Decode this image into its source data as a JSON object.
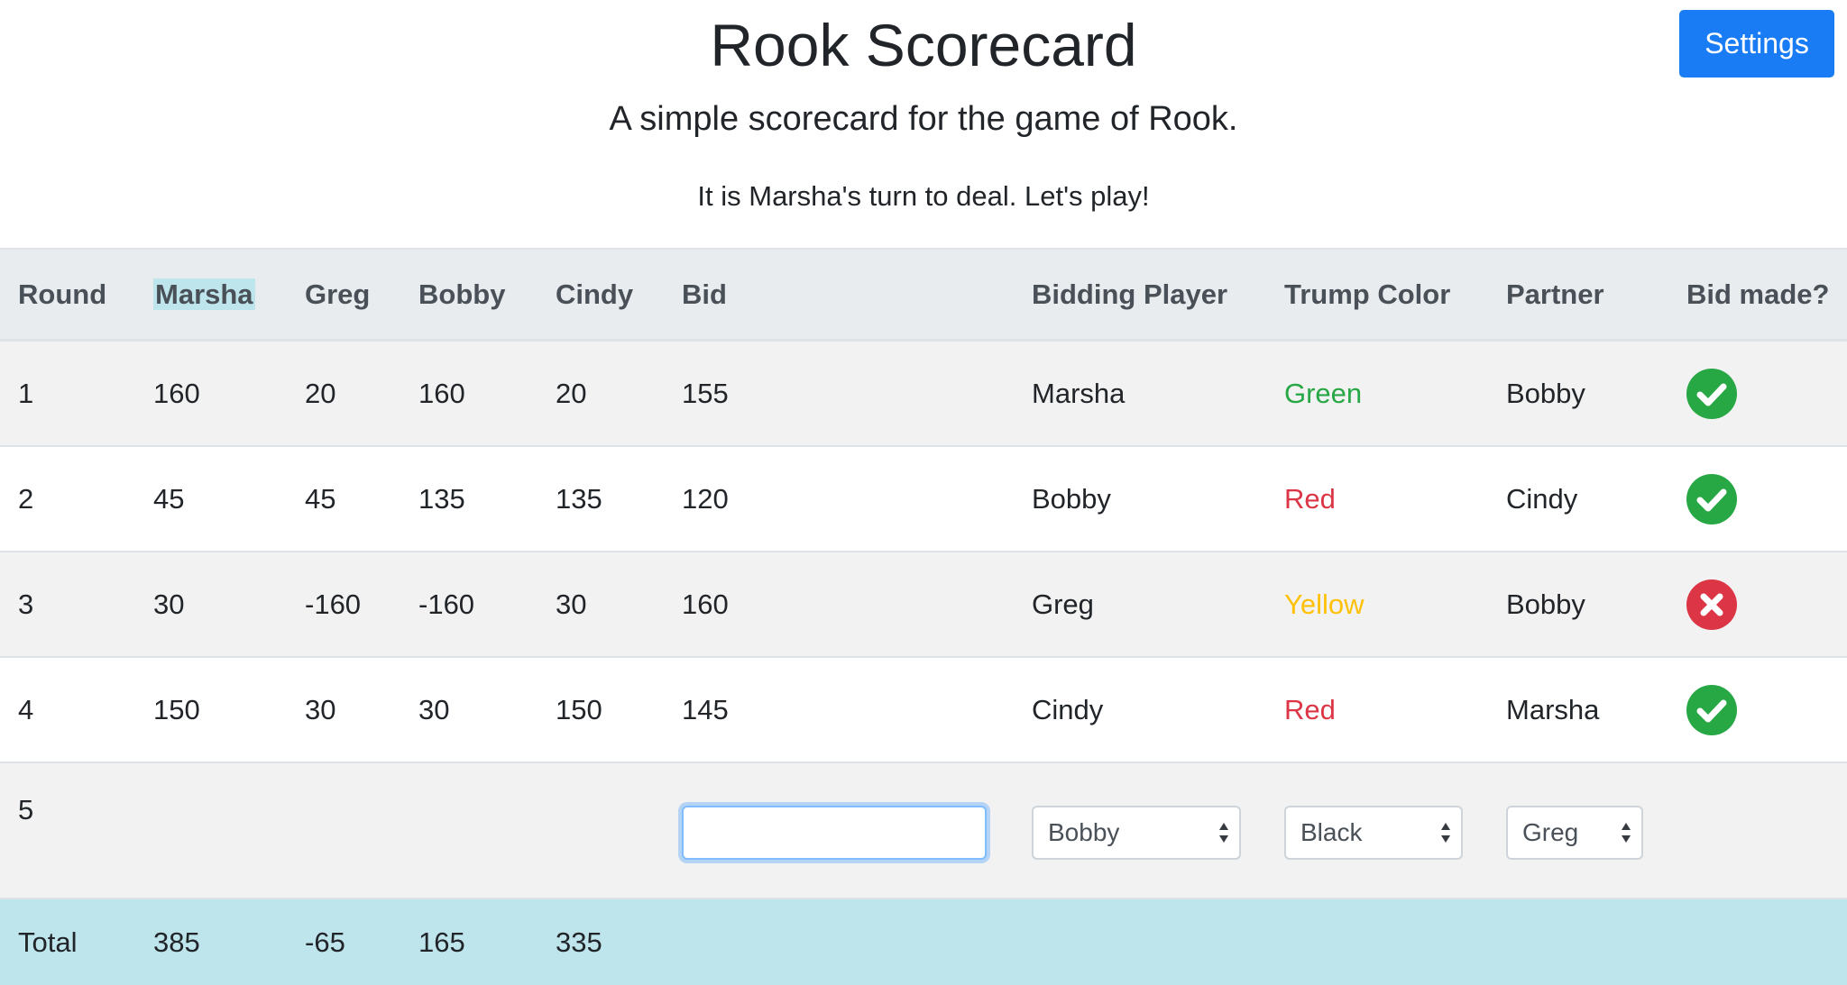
{
  "header": {
    "title": "Rook Scorecard",
    "subtitle": "A simple scorecard for the game of Rook.",
    "turn_message": "It is Marsha's turn to deal. Let's play!",
    "settings_label": "Settings"
  },
  "table": {
    "columns": [
      "Round",
      "Marsha",
      "Greg",
      "Bobby",
      "Cindy",
      "Bid",
      "Bidding Player",
      "Trump Color",
      "Partner",
      "Bid made?"
    ],
    "highlighted_column": "Marsha",
    "rows": [
      {
        "round": "1",
        "marsha": "160",
        "greg": "20",
        "bobby": "160",
        "cindy": "20",
        "bid": "155",
        "bidding_player": "Marsha",
        "trump_color": "Green",
        "trump_color_hex": "#28a745",
        "partner": "Bobby",
        "bid_made": "yes"
      },
      {
        "round": "2",
        "marsha": "45",
        "greg": "45",
        "bobby": "135",
        "cindy": "135",
        "bid": "120",
        "bidding_player": "Bobby",
        "trump_color": "Red",
        "trump_color_hex": "#dc3545",
        "partner": "Cindy",
        "bid_made": "yes"
      },
      {
        "round": "3",
        "marsha": "30",
        "greg": "-160",
        "bobby": "-160",
        "cindy": "30",
        "bid": "160",
        "bidding_player": "Greg",
        "trump_color": "Yellow",
        "trump_color_hex": "#ffc107",
        "partner": "Bobby",
        "bid_made": "no"
      },
      {
        "round": "4",
        "marsha": "150",
        "greg": "30",
        "bobby": "30",
        "cindy": "150",
        "bid": "145",
        "bidding_player": "Cindy",
        "trump_color": "Red",
        "trump_color_hex": "#dc3545",
        "partner": "Marsha",
        "bid_made": "yes"
      }
    ],
    "entry_row": {
      "round": "5",
      "bid_value": "",
      "bidding_player_selected": "Bobby",
      "trump_color_selected": "Black",
      "partner_selected": "Greg"
    },
    "total_row": {
      "label": "Total",
      "marsha": "385",
      "greg": "-65",
      "bobby": "165",
      "cindy": "335"
    }
  },
  "colors": {
    "accent": "#1a7cf5",
    "success": "#28a745",
    "danger": "#dc3545",
    "warning": "#ffc107",
    "total_row_bg": "#bee5eb"
  },
  "icons": {
    "bid_made_yes": "check-circle-icon",
    "bid_made_no": "x-circle-icon",
    "select_arrows": "chevron-up-down-icon"
  }
}
